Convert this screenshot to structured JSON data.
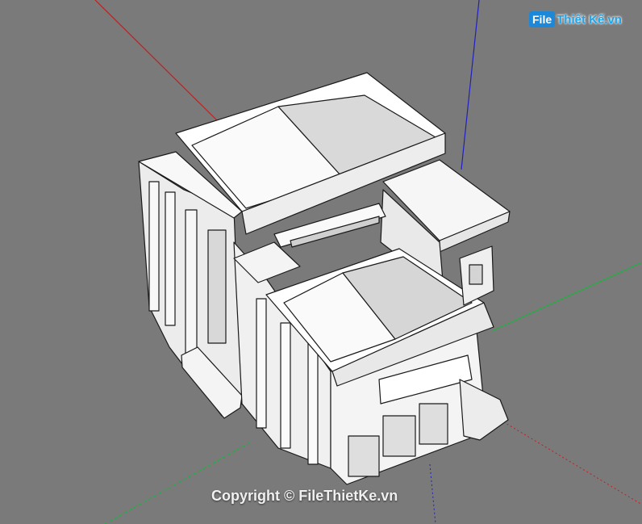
{
  "watermark": {
    "logo_box": "File",
    "logo_text": "Thiết Kế.vn",
    "copyright": "Copyright © FileThietKe.vn"
  },
  "colors": {
    "background": "#7a7a7a",
    "axis_red": "#c02020",
    "axis_blue": "#2020c0",
    "axis_green": "#20b040",
    "model_face": "#f2f2f2",
    "model_shade": "#d6d6d6",
    "model_line": "#1a1a1a"
  },
  "icons": [
    "file-logo-icon"
  ]
}
